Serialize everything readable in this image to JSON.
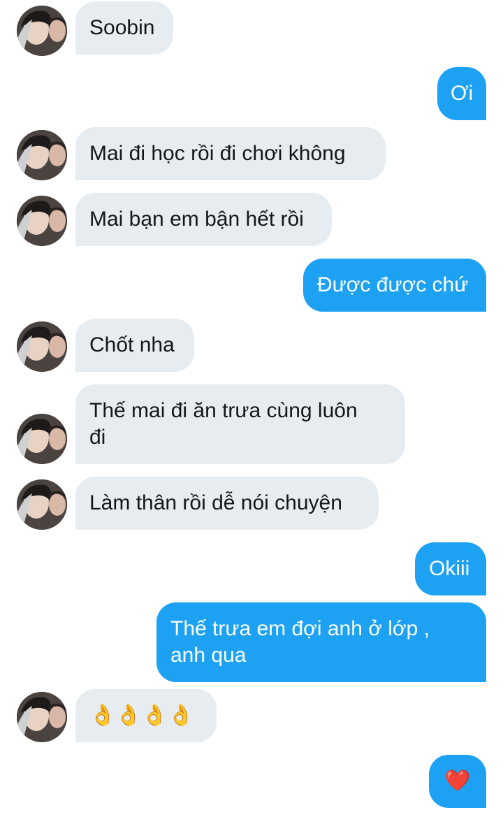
{
  "conversation": {
    "messages": [
      {
        "side": "in",
        "text": "Soobin"
      },
      {
        "side": "out",
        "text": "Ơi"
      },
      {
        "side": "in",
        "text": "Mai đi học rồi đi chơi không"
      },
      {
        "side": "in",
        "text": "Mai bạn em bận hết rồi"
      },
      {
        "side": "out",
        "text": "Được được chứ"
      },
      {
        "side": "in",
        "text": "Chốt nha"
      },
      {
        "side": "in",
        "text": "Thế mai đi ăn trưa cùng luôn\nđi"
      },
      {
        "side": "in",
        "text": "Làm thân rồi dễ nói chuyện"
      },
      {
        "side": "out",
        "text": "Okiii"
      },
      {
        "side": "out",
        "text": "Thế trưa em đợi anh ở lớp ,\nanh qua"
      },
      {
        "side": "in",
        "text": "👌👌👌👌",
        "icon": "ok-hand-icon"
      },
      {
        "side": "out",
        "text": "❤️",
        "icon": "red-heart-icon"
      }
    ]
  },
  "colors": {
    "incoming_bubble": "#e6ecf0",
    "outgoing_bubble": "#1da1f2",
    "incoming_text": "#14171a",
    "outgoing_text": "#ffffff"
  }
}
